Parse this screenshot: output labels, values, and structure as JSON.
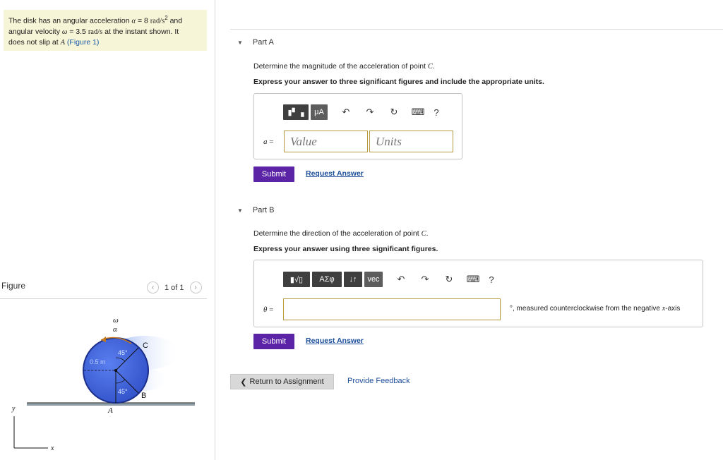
{
  "problem": {
    "line1_pre": "The disk has an angular acceleration",
    "alpha_sym": "α",
    "line1_mid": "= 8",
    "alpha_unit": "rad/s",
    "alpha_unit_exp": "2",
    "line1_post": "and",
    "line2_pre": "angular velocity",
    "omega_sym": "ω",
    "line2_mid": "= 3.5",
    "omega_unit": "rad/s",
    "line2_post": "at the instant shown. It",
    "line3_pre": "does not slip at",
    "point_a": "A",
    "figure_link": "(Figure 1)"
  },
  "figure": {
    "label": "Figure",
    "pager_prev": "‹",
    "pager_text": "1 of 1",
    "pager_next": "›",
    "omega_label": "ω",
    "alpha_label": "α",
    "radius_label": "0.5 m",
    "angle_top": "45°",
    "angle_bottom": "45°",
    "point_c": "C",
    "point_b": "B",
    "point_a": "A",
    "axis_y": "y",
    "axis_x": "x",
    "colors": {
      "disk": "#3f63d6",
      "disk_edge": "#1b2e8a",
      "glow": "#7fa1ef",
      "ground": "#4a4a4a"
    }
  },
  "partA": {
    "title": "Part A",
    "q1_pre": "Determine the magnitude of the acceleration of point",
    "q1_sym": "C",
    "q1_post": ".",
    "q2": "Express your answer to three significant figures and include the appropriate units.",
    "toolbar": {
      "b1": "▮▘▗",
      "b2": "μA",
      "undo": "↶",
      "redo": "↷",
      "reset": "↻",
      "keyboard": "⌨",
      "help": "?"
    },
    "var": "a",
    "eq": "=",
    "value_placeholder": "Value",
    "units_placeholder": "Units",
    "submit": "Submit",
    "request": "Request Answer"
  },
  "partB": {
    "title": "Part B",
    "q1_pre": "Determine the direction of the acceleration of point",
    "q1_sym": "C",
    "q1_post": ".",
    "q2": "Express your answer using three significant figures.",
    "toolbar": {
      "b1": "▮√▯",
      "b2": "ΑΣφ",
      "b3": "↓↑",
      "b4": "vec",
      "undo": "↶",
      "redo": "↷",
      "reset": "↻",
      "keyboard": "⌨",
      "help": "?"
    },
    "var": "θ",
    "eq": "=",
    "note_pre": "°, measured counterclockwise from the negative",
    "note_sym": "x",
    "note_post": "-axis",
    "submit": "Submit",
    "request": "Request Answer"
  },
  "footer": {
    "return_icon": "❮",
    "return": "Return to Assignment",
    "feedback": "Provide Feedback"
  },
  "colors": {
    "submit": "#5b23a6",
    "link": "#1c4e9a",
    "problem_bg": "#f7f5d7",
    "field_border": "#b89a3c"
  }
}
